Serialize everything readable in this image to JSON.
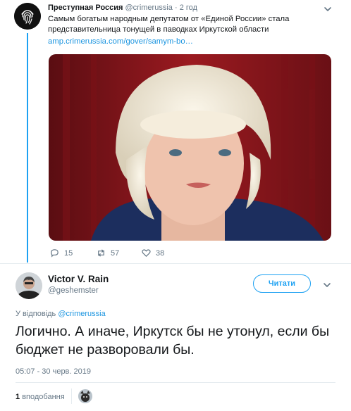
{
  "original_tweet": {
    "author_name": "Преступная Россия",
    "author_handle": "@crimerussia",
    "separator": "·",
    "time_ago": "2 год",
    "text": "Самым богатым народным депутатом от «Единой России» стала представительница тонущей в паводках Иркутской области",
    "link": "amp.crimerussia.com/gover/samym-bo…",
    "reply_count": "15",
    "retweet_count": "57",
    "like_count": "38"
  },
  "reply_tweet": {
    "author_name": "Victor V. Rain",
    "author_handle": "@geshemster",
    "follow_label": "Читати",
    "replying_to_prefix": "У відповідь",
    "replying_to_handle": "@crimerussia",
    "text": "Логично. А иначе, Иркутск бы не утонул, если бы бюджет не разворовали бы.",
    "timestamp": "05:07 - 30 черв. 2019",
    "likes_count": "1",
    "likes_label": "вподобання"
  },
  "colors": {
    "accent": "#1da1f2",
    "link": "#1b95e0",
    "muted": "#657786",
    "text": "#14171a"
  },
  "icons": [
    "fingerprint-icon",
    "chevron-down-icon",
    "reply-icon",
    "retweet-icon",
    "heart-icon"
  ]
}
